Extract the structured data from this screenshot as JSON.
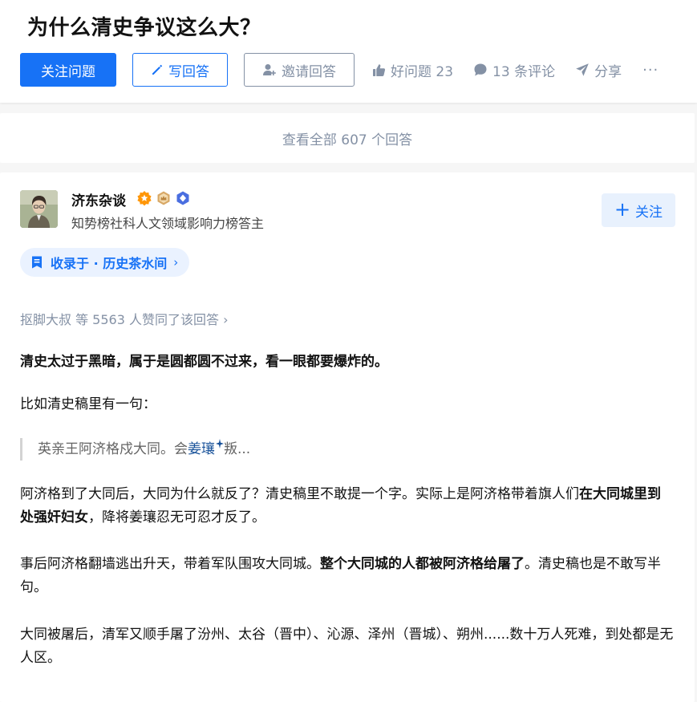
{
  "question": {
    "title": "为什么清史争议这么大？"
  },
  "actions": {
    "follow_question": "关注问题",
    "write_answer": "写回答",
    "invite_answer": "邀请回答",
    "good_question": "好问题 23",
    "comments": "13 条评论",
    "share": "分享",
    "more": "···"
  },
  "view_all": "查看全部 607 个回答",
  "answer": {
    "author": {
      "name": "济东杂谈",
      "bio": "知势榜社科人文领域影响力榜答主",
      "follow_label": "关注"
    },
    "collection": {
      "label": "收录于 · 历史茶水间",
      "chevron": "›"
    },
    "voters": "抠脚大叔 等 5563 人赞同了该回答 ›",
    "paragraphs": {
      "p1": "清史太过于黑暗，属于是圆都圆不过来，看一眼都要爆炸的。",
      "p2": "比如清史稿里有一句：",
      "quote_before": "英亲王阿济格戍大同。会",
      "quote_keyword": "姜瓖",
      "quote_after": "叛...",
      "p3_a": "阿济格到了大同后，大同为什么就反了？清史稿里不敢提一个字。实际上是阿济格带着旗人们",
      "p3_b": "在大同城里到处强奸妇女",
      "p3_c": "，降将姜瓖忍无可忍才反了。",
      "p4_a": "事后阿济格翻墙逃出升天，带着军队围攻大同城。",
      "p4_b": "整个大同城的人都被阿济格给屠了",
      "p4_c": "。清史稿也是不敢写半句。",
      "p5": "大同被屠后，清军又顺手屠了汾州、太谷（晋中）、沁源、泽州（晋城）、朔州......数十万人死难，到处都是无人区。"
    }
  },
  "colors": {
    "brand_blue": "#1772f6",
    "muted_gray": "#8491a5",
    "link_blue": "#175199"
  }
}
